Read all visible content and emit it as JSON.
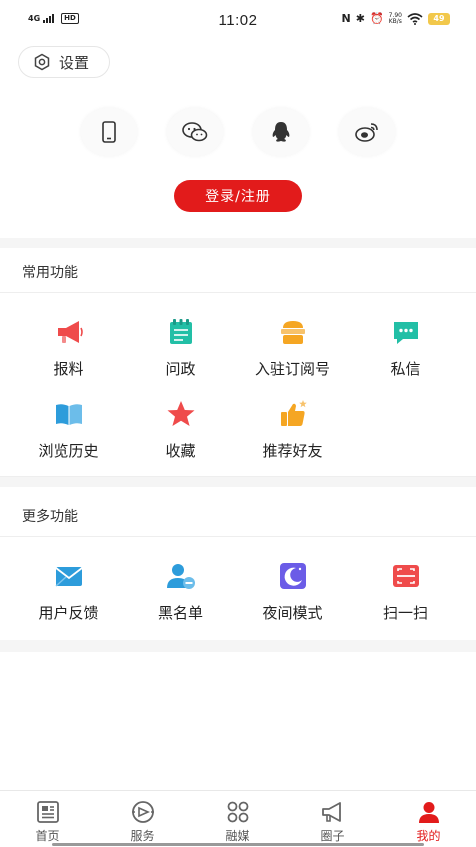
{
  "status_bar": {
    "network": "4G",
    "hd": "HD",
    "time": "11:02",
    "speed_value": "7.90",
    "speed_unit": "KB/s",
    "battery": "49"
  },
  "header": {
    "settings_label": "设置",
    "login_methods": [
      "phone-icon",
      "wechat-icon",
      "qq-icon",
      "weibo-icon"
    ],
    "login_label": "登录/注册"
  },
  "common": {
    "title": "常用功能",
    "items": [
      {
        "label": "报料",
        "icon": "megaphone-icon",
        "color": "#ef4b4b"
      },
      {
        "label": "问政",
        "icon": "notepad-icon",
        "color": "#22bfa6"
      },
      {
        "label": "入驻订阅号",
        "icon": "subscribe-box-icon",
        "color": "#f5a623"
      },
      {
        "label": "私信",
        "icon": "message-icon",
        "color": "#22bfa6"
      },
      {
        "label": "浏览历史",
        "icon": "book-icon",
        "color": "#2d9cdb"
      },
      {
        "label": "收藏",
        "icon": "star-icon",
        "color": "#ef4b4b"
      },
      {
        "label": "推荐好友",
        "icon": "thumbs-up-icon",
        "color": "#f5a623"
      }
    ]
  },
  "more": {
    "title": "更多功能",
    "items": [
      {
        "label": "用户反馈",
        "icon": "feedback-mail-icon",
        "color": "#2d9cdb"
      },
      {
        "label": "黑名单",
        "icon": "block-user-icon",
        "color": "#2d9cdb"
      },
      {
        "label": "夜间模式",
        "icon": "moon-icon",
        "color": "#6b5ce7"
      },
      {
        "label": "扫一扫",
        "icon": "scan-icon",
        "color": "#ef4b4b"
      }
    ]
  },
  "tabs": [
    {
      "label": "首页",
      "icon": "news-icon"
    },
    {
      "label": "服务",
      "icon": "service-icon"
    },
    {
      "label": "融媒",
      "icon": "grid-icon"
    },
    {
      "label": "圈子",
      "icon": "megaphone-outline-icon"
    },
    {
      "label": "我的",
      "icon": "user-icon",
      "active": true
    }
  ],
  "colors": {
    "accent": "#e21b1b",
    "band": "#f5f5f5"
  }
}
